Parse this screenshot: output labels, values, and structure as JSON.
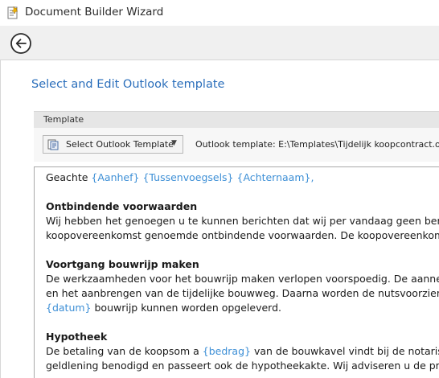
{
  "window": {
    "title": "Document Builder Wizard",
    "app_icon": "wizard-document-icon"
  },
  "nav": {
    "back_icon": "back-arrow-icon"
  },
  "page": {
    "title": "Select and Edit Outlook template"
  },
  "template_section": {
    "label": "Template",
    "select_button_label": "Select Outlook Template",
    "select_button_icon": "outlook-template-icon",
    "caret": "▼",
    "path_text": "Outlook template: E:\\Templates\\Tijdelijk koopcontract.oft"
  },
  "document": {
    "greeting": "Geachte ",
    "greeting_fields": [
      "{Aanhef}",
      "{Tussenvoegsels}",
      "{Achternaam}"
    ],
    "greeting_end": ",",
    "sections": [
      {
        "heading": "Ontbindende voorwaarden",
        "lines": [
          "Wij hebben het genoegen u te kunnen berichten dat wij per vandaag geen beroe",
          "koopovereenkomst genoemde ontbindende voorwaarden. De koopovereenkom"
        ]
      },
      {
        "heading": "Voortgang bouwrijp maken",
        "lines": [
          "De werkzaamheden voor het bouwrijp maken verlopen voorspoedig. De aannem",
          "en het aanbrengen van de tijdelijke bouwweg. Daarna worden de nutsvoorzienin"
        ],
        "field_line": {
          "field": "{datum}",
          "text": " bouwrijp kunnen worden opgeleverd."
        }
      },
      {
        "heading": "Hypotheek",
        "line1_prefix": "De betaling van de koopsom a ",
        "line1_field": "{bedrag}",
        "line1_suffix": " van de bouwkavel vindt bij de notaris pla",
        "lines": [
          "geldlening benodigd en passeert ook de hypotheekakte. Wij adviseren u de proc"
        ]
      }
    ]
  },
  "colors": {
    "accent": "#2a6ebb",
    "field": "#3d8fd6"
  }
}
